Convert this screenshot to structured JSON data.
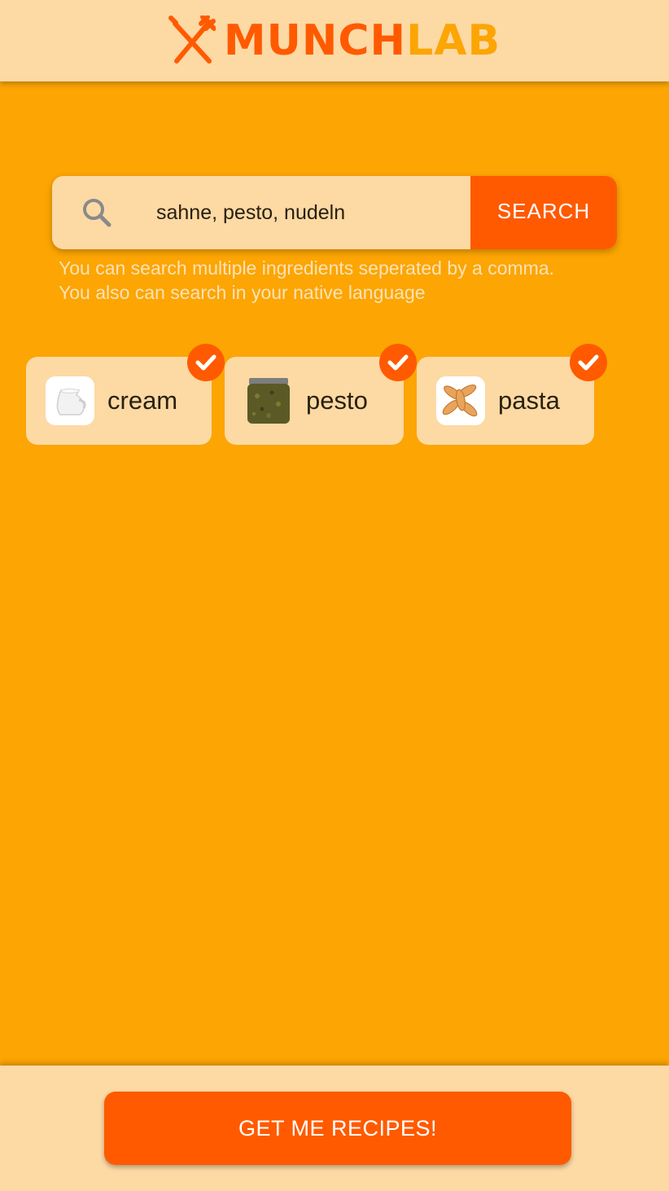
{
  "header": {
    "logo_part1": "MUNCH",
    "logo_part2": "LAB",
    "logo_icon": "fork-knife-icon"
  },
  "search": {
    "value": "sahne, pesto, nudeln",
    "icon": "search-icon",
    "button_label": "SEARCH",
    "hint_line1": "You can search multiple ingredients seperated by a comma.",
    "hint_line2": "You also can search in your native language"
  },
  "ingredients": [
    {
      "label": "cream",
      "image": "cream-jug-image",
      "selected": true
    },
    {
      "label": "pesto",
      "image": "pesto-jar-image",
      "selected": true
    },
    {
      "label": "pasta",
      "image": "pasta-fusilli-image",
      "selected": true
    }
  ],
  "footer": {
    "cta_label": "GET ME RECIPES!"
  },
  "colors": {
    "background": "#fca503",
    "panel": "#fdd9a4",
    "accent": "#ff5a00"
  }
}
